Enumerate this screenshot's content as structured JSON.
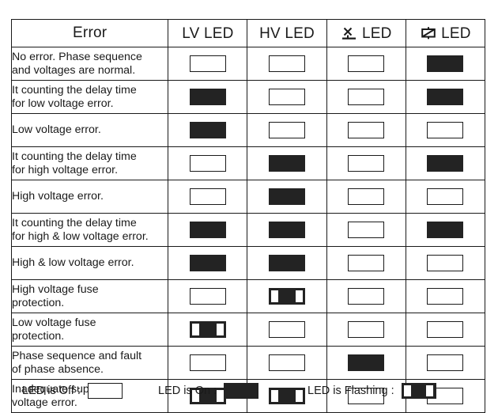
{
  "table": {
    "headers": [
      {
        "label": "Error",
        "icon": null
      },
      {
        "label": "LV LED",
        "icon": null
      },
      {
        "label": "HV LED",
        "icon": null
      },
      {
        "label": "LED",
        "icon": "phase-sequence-icon"
      },
      {
        "label": "LED",
        "icon": "fuse-icon"
      }
    ],
    "rows": [
      {
        "description": [
          "No error. Phase sequence",
          "and voltages are normal."
        ],
        "states": [
          "off",
          "off",
          "off",
          "on"
        ]
      },
      {
        "description": [
          "It counting the delay time",
          "for low voltage error."
        ],
        "states": [
          "on",
          "off",
          "off",
          "on"
        ]
      },
      {
        "description": [
          "Low voltage error."
        ],
        "states": [
          "on",
          "off",
          "off",
          "off"
        ]
      },
      {
        "description": [
          "It counting the delay time",
          "for high voltage error."
        ],
        "states": [
          "off",
          "on",
          "off",
          "on"
        ]
      },
      {
        "description": [
          "High voltage error."
        ],
        "states": [
          "off",
          "on",
          "off",
          "off"
        ]
      },
      {
        "description": [
          "It counting the delay time",
          "for high & low voltage error."
        ],
        "states": [
          "on",
          "on",
          "off",
          "on"
        ]
      },
      {
        "description": [
          "High & low voltage error."
        ],
        "states": [
          "on",
          "on",
          "off",
          "off"
        ]
      },
      {
        "description": [
          "High voltage fuse",
          "protection."
        ],
        "states": [
          "off",
          "flashing",
          "off",
          "off"
        ]
      },
      {
        "description": [
          "Low voltage fuse",
          "protection."
        ],
        "states": [
          "flashing",
          "off",
          "off",
          "off"
        ]
      },
      {
        "description": [
          "Phase sequence and fault",
          "of phase absence."
        ],
        "states": [
          "off",
          "off",
          "on",
          "off"
        ]
      },
      {
        "description": [
          "Inadequate supply",
          "voltage error."
        ],
        "states": [
          "flashing",
          "flashing",
          "off",
          "off"
        ]
      }
    ]
  },
  "legend": {
    "off": {
      "label": "LED is Off :",
      "state": "off"
    },
    "on": {
      "label": "LED is On :",
      "state": "on"
    },
    "flashing": {
      "label": "LED is Flashing :",
      "state": "flashing"
    }
  },
  "colors": {
    "ink": "#1a1a1a",
    "led_on": "#232323",
    "background": "#ffffff"
  }
}
